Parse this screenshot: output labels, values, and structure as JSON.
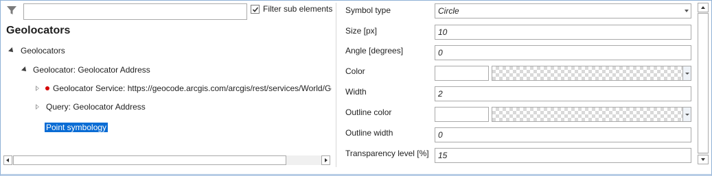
{
  "filter": {
    "placeholder": "",
    "value": "",
    "checkbox_label": "Filter sub elements",
    "checked": true
  },
  "title": "Geolocators",
  "tree": {
    "root": "Geolocators",
    "geolocator": "Geolocator: Geolocator Address",
    "service": "Geolocator Service: https://geocode.arcgis.com/arcgis/rest/services/World/Geoc",
    "query": "Query: Geolocator Address",
    "selected": "Point symbology"
  },
  "properties": {
    "symbol_type": {
      "label": "Symbol type",
      "value": "Circle"
    },
    "size": {
      "label": "Size [px]",
      "value": "10"
    },
    "angle": {
      "label": "Angle [degrees]",
      "value": "0"
    },
    "color": {
      "label": "Color",
      "value": ""
    },
    "width": {
      "label": "Width",
      "value": "2"
    },
    "outline_color": {
      "label": "Outline color",
      "value": ""
    },
    "outline_width": {
      "label": "Outline width",
      "value": "0"
    },
    "transparency": {
      "label": "Transparency level [%]",
      "value": "15"
    }
  },
  "colors": {
    "selection": "#0a6cd4",
    "status_dot": "#d40000",
    "frame": "#8fb0d6"
  },
  "icons": [
    "filter-icon",
    "checkbox-check-icon",
    "expand-open-icon",
    "expand-closed-icon",
    "status-dot-icon",
    "dropdown-arrow-icon"
  ]
}
